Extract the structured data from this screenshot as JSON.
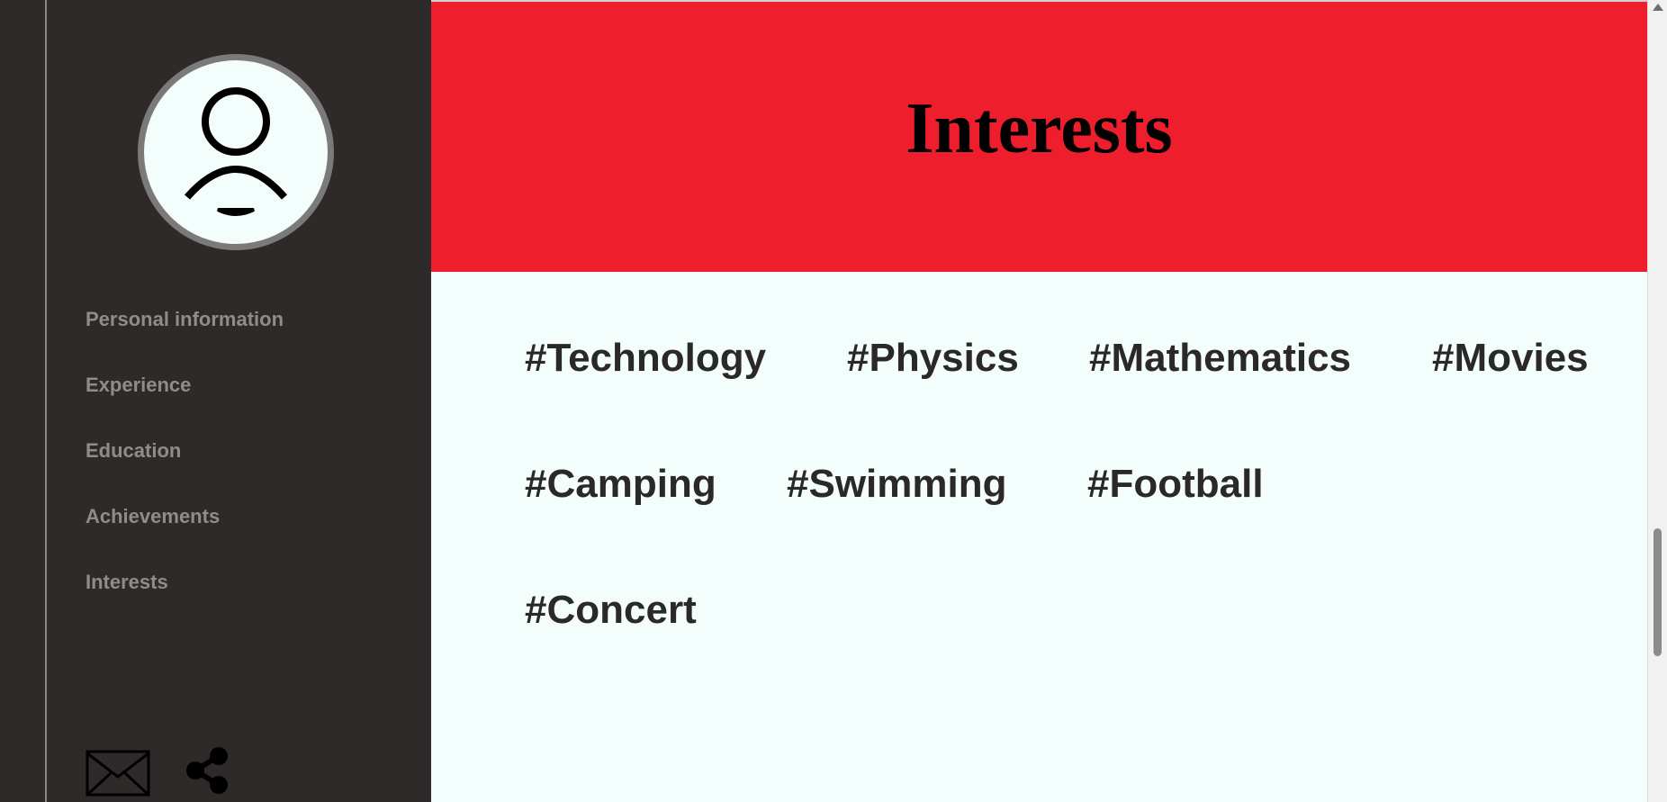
{
  "sidebar": {
    "avatar_icon": "user-avatar-icon",
    "nav": [
      {
        "label": "Personal information"
      },
      {
        "label": "Experience"
      },
      {
        "label": "Education"
      },
      {
        "label": "Achievements"
      },
      {
        "label": "Interests"
      }
    ],
    "contact_icons": [
      "mail-icon",
      "share-icon"
    ]
  },
  "main": {
    "hero": {
      "title": "Interests",
      "background": "#ee1e2d"
    },
    "tags": [
      "#Technology",
      "#Physics",
      "#Mathematics",
      "#Movies",
      "#Camping",
      "#Swimming",
      "#Football",
      "#Concert"
    ]
  },
  "colors": {
    "sidebar_bg": "#2e2a29",
    "nav_text": "#8f8c8b",
    "content_bg": "#f3fdfc",
    "tag_text": "#2b2828"
  }
}
